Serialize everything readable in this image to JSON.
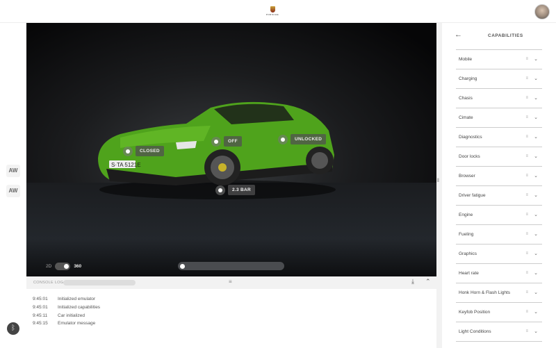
{
  "header": {
    "brand": "PORSCHE",
    "avatar": "user-avatar"
  },
  "leftbar": {
    "buttons": [
      "AW",
      "AW"
    ],
    "bluetooth_icon": "bluetooth-icon"
  },
  "viewer": {
    "license_plate": "S·TA 5121E",
    "hotspots": [
      {
        "name": "hood",
        "label": "CLOSED"
      },
      {
        "name": "lights",
        "label": "OFF"
      },
      {
        "name": "doors",
        "label": "UNLOCKED"
      },
      {
        "name": "tire-pressure",
        "label": "2.3 BAR"
      }
    ],
    "view_toggle": {
      "left": "2D",
      "right": "360",
      "selected": "360"
    },
    "rotation_slider": 0.0
  },
  "console": {
    "title": "CONSOLE LOG",
    "entries": [
      {
        "time": "9:45:01",
        "message": "Initialized emulator"
      },
      {
        "time": "9:45:01",
        "message": "Initialized capabilities"
      },
      {
        "time": "9:45:11",
        "message": "Car initialized"
      },
      {
        "time": "9:45:15",
        "message": "Emulator message"
      }
    ]
  },
  "panel": {
    "title": "CAPABILITIES",
    "items": [
      "Mobile",
      "Charging",
      "Chasis",
      "Cimate",
      "Diagnostics",
      "Door locks",
      "Browser",
      "Driver fatigue",
      "Engine",
      "Fueling",
      "Graphics",
      "Heart rate",
      "Honk Horn & Flash Lights",
      "Keyfob Position",
      "Light Conditions"
    ]
  },
  "colors": {
    "car": "#4fa31c",
    "accent": "#333333"
  }
}
